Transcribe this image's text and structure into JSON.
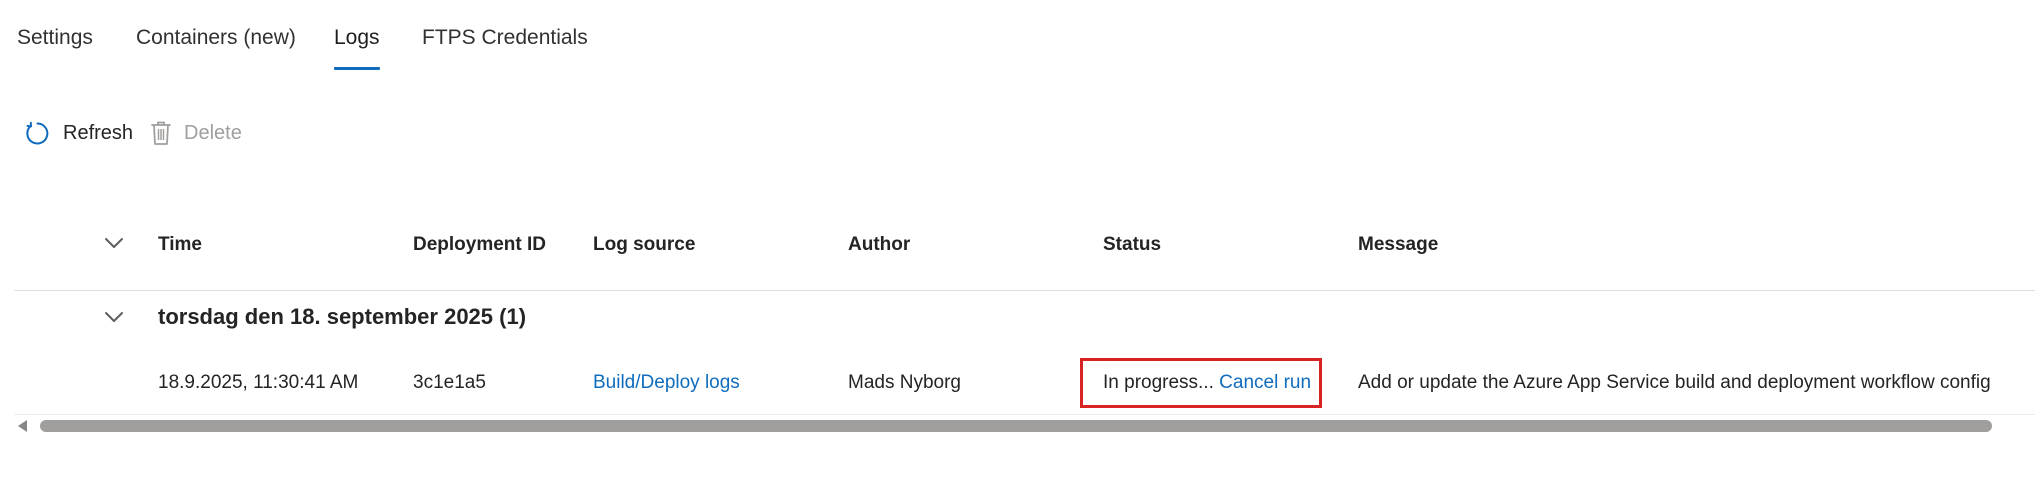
{
  "tabs": [
    {
      "label": "Settings",
      "active": false
    },
    {
      "label": "Containers (new)",
      "active": false
    },
    {
      "label": "Logs",
      "active": true
    },
    {
      "label": "FTPS Credentials",
      "active": false
    }
  ],
  "toolbar": {
    "refresh_label": "Refresh",
    "refresh_icon": "refresh-icon",
    "delete_label": "Delete",
    "delete_icon": "trash-icon"
  },
  "grid": {
    "columns": [
      "Time",
      "Deployment ID",
      "Log source",
      "Author",
      "Status",
      "Message"
    ],
    "groups": [
      {
        "title": "torsdag den 18. september 2025 (1)",
        "rows": [
          {
            "time": "18.9.2025, 11:30:41 AM",
            "deployment_id": "3c1e1a5",
            "log_source": "Build/Deploy logs",
            "author": "Mads Nyborg",
            "status": "In progress...",
            "status_action": "Cancel run",
            "message": "Add or update the Azure App Service build and deployment workflow config"
          }
        ]
      }
    ]
  },
  "colors": {
    "accent": "#0f6cbd",
    "highlight_border": "#d92222",
    "disabled_text": "#a19f9d"
  }
}
